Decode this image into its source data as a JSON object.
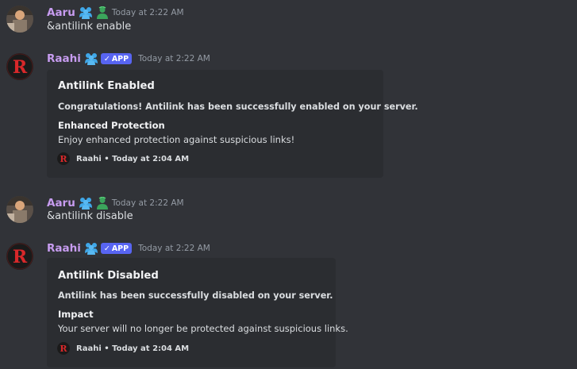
{
  "colors": {
    "background": "#313338",
    "embed_background": "#2b2d31",
    "username": "#c79cf0",
    "app_badge": "#5865f2",
    "timestamp": "#949ba4"
  },
  "messages": [
    {
      "author": "Aaru",
      "role_icons": [
        "members-icon",
        "green-member-icon"
      ],
      "timestamp": "Today at 2:22 AM",
      "content": "&antilink enable"
    },
    {
      "author": "Raahi",
      "role_icons": [
        "members-icon"
      ],
      "badge": "APP",
      "timestamp": "Today at 2:22 AM",
      "embed": {
        "title": "Antilink Enabled",
        "description": "Congratulations! Antilink has been successfully enabled on your server.",
        "field_name": "Enhanced Protection",
        "field_value": "Enjoy enhanced protection against suspicious links!",
        "footer": "Raahi • Today at 2:04 AM"
      }
    },
    {
      "author": "Aaru",
      "role_icons": [
        "members-icon",
        "green-member-icon"
      ],
      "timestamp": "Today at 2:22 AM",
      "content": "&antilink disable"
    },
    {
      "author": "Raahi",
      "role_icons": [
        "members-icon"
      ],
      "badge": "APP",
      "timestamp": "Today at 2:22 AM",
      "embed": {
        "title": "Antilink Disabled",
        "description": "Antilink has been successfully disabled on your server.",
        "field_name": "Impact",
        "field_value": "Your server will no longer be protected against suspicious links.",
        "footer": "Raahi • Today at 2:04 AM"
      }
    }
  ]
}
